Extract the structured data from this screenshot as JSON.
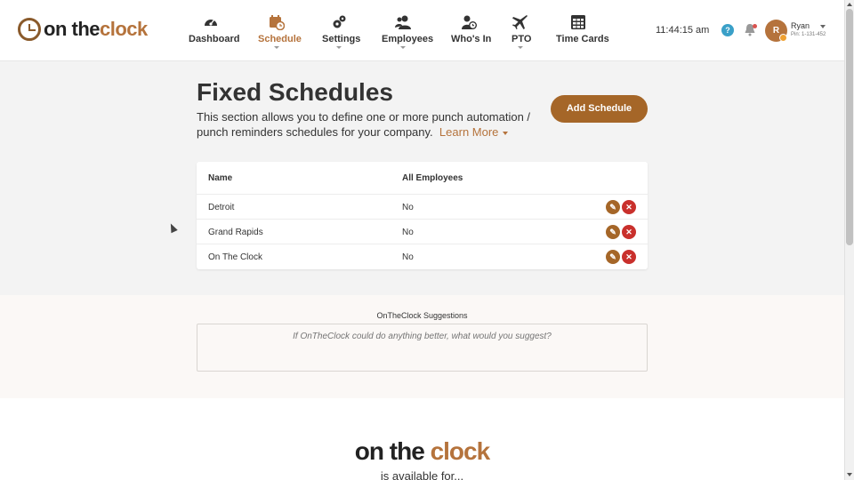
{
  "brand": {
    "part1": "on the",
    "part2": "clock",
    "accent": "#b5733c",
    "button_color": "#a56628",
    "danger_color": "#c9302c"
  },
  "nav": {
    "items": [
      {
        "label": "Dashboard",
        "icon": "dashboard-gauge-icon"
      },
      {
        "label": "Schedule",
        "icon": "calendar-clock-icon",
        "active": true
      },
      {
        "label": "Settings",
        "icon": "gears-icon"
      },
      {
        "label": "Employees",
        "icon": "users-icon"
      },
      {
        "label": "Who's In",
        "icon": "user-clock-icon"
      },
      {
        "label": "PTO",
        "icon": "plane-icon"
      },
      {
        "label": "Time Cards",
        "icon": "table-grid-icon"
      }
    ]
  },
  "header": {
    "time": "11:44:15 am",
    "help": "?",
    "user": {
      "initial": "R",
      "name": "Ryan",
      "pin": "Pin: 1-131-452"
    }
  },
  "page": {
    "title": "Fixed Schedules",
    "description": "This section allows you to define one or more punch automation / punch reminders schedules for your company.",
    "learn_more": "Learn More",
    "add_button": "Add Schedule"
  },
  "table": {
    "headers": [
      "Name",
      "All Employees"
    ],
    "rows": [
      {
        "name": "Detroit",
        "all_employees": "No"
      },
      {
        "name": "Grand Rapids",
        "all_employees": "No"
      },
      {
        "name": "On The Clock",
        "all_employees": "No"
      }
    ]
  },
  "suggestions": {
    "label": "OnTheClock Suggestions",
    "placeholder": "If OnTheClock could do anything better, what would you suggest?"
  },
  "footer": {
    "logo_part1": "on the",
    "logo_part2": "clock",
    "tagline": "is available for..."
  }
}
